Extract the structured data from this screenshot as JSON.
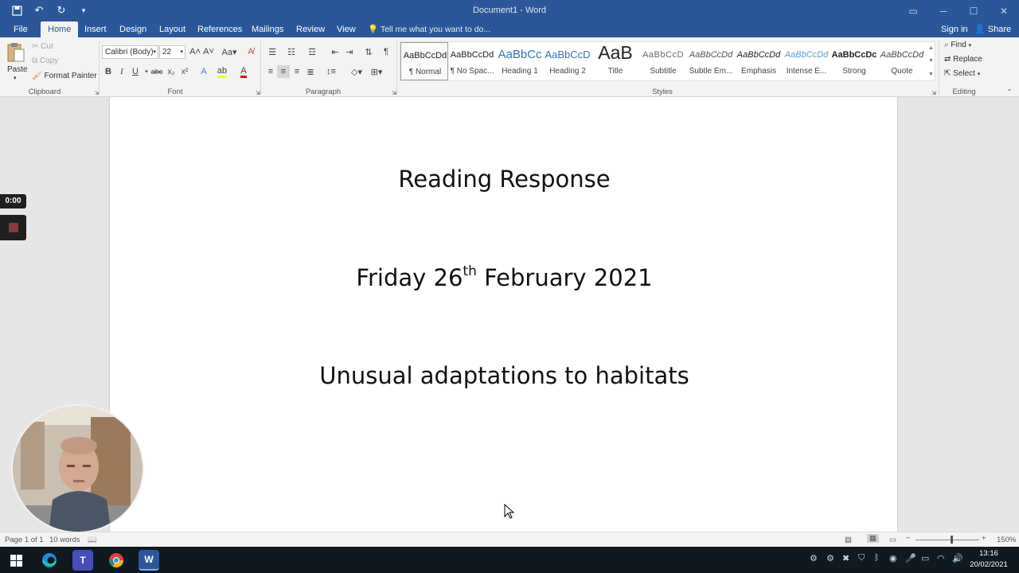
{
  "window": {
    "title": "Document1 - Word",
    "sign_in": "Sign in",
    "share": "Share"
  },
  "tabs": [
    "File",
    "Home",
    "Insert",
    "Design",
    "Layout",
    "References",
    "Mailings",
    "Review",
    "View"
  ],
  "active_tab": "Home",
  "tell_me": "Tell me what you want to do...",
  "clipboard": {
    "paste": "Paste",
    "cut": "Cut",
    "copy": "Copy",
    "format_painter": "Format Painter",
    "label": "Clipboard"
  },
  "font": {
    "name": "Calibri (Body)",
    "size": "22",
    "label": "Font",
    "bold": "B",
    "italic": "I",
    "underline": "U"
  },
  "paragraph": {
    "label": "Paragraph"
  },
  "styles": {
    "label": "Styles",
    "items": [
      {
        "sample": "AaBbCcDd",
        "name": "¶ Normal"
      },
      {
        "sample": "AaBbCcDd",
        "name": "¶ No Spac..."
      },
      {
        "sample": "AaBbCc",
        "name": "Heading 1"
      },
      {
        "sample": "AaBbCcD",
        "name": "Heading 2"
      },
      {
        "sample": "AaB",
        "name": "Title"
      },
      {
        "sample": "AaBbCcD",
        "name": "Subtitle"
      },
      {
        "sample": "AaBbCcDd",
        "name": "Subtle Em..."
      },
      {
        "sample": "AaBbCcDd",
        "name": "Emphasis"
      },
      {
        "sample": "AaBbCcDd",
        "name": "Intense E..."
      },
      {
        "sample": "AaBbCcDc",
        "name": "Strong"
      },
      {
        "sample": "AaBbCcDd",
        "name": "Quote"
      }
    ]
  },
  "editing": {
    "label": "Editing",
    "find": "Find",
    "replace": "Replace",
    "select": "Select"
  },
  "document": {
    "line1": "Reading Response",
    "line2_pre": "Friday 26",
    "line2_sup": "th",
    "line2_post": " February 2021",
    "line3": "Unusual adaptations to habitats"
  },
  "recorder": {
    "timer": "0:00"
  },
  "statusbar": {
    "page": "Page 1 of 1",
    "words": "10 words",
    "zoom": "150%"
  },
  "taskbar": {
    "time": "13:16",
    "date": "20/02/2021"
  },
  "colors": {
    "brand": "#2b579a",
    "ribbon": "#f3f3f3",
    "taskbar": "#101820"
  }
}
